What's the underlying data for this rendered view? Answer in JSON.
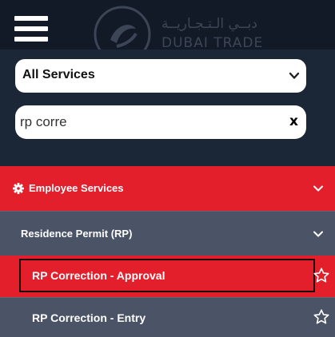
{
  "header": {
    "logo_arabic": "دبــي الـتـجـاريــة",
    "logo_english": "DUBAI TRADE"
  },
  "filters": {
    "service_select": "All Services",
    "search_value": "rp corre",
    "clear_label": "x"
  },
  "menu": {
    "employee_services": "Employee Services",
    "residence_permit": "Residence Permit (RP)",
    "items": [
      {
        "label": "RP Correction - Approval",
        "selected": true
      },
      {
        "label": "RP Correction - Entry",
        "selected": false
      }
    ]
  },
  "colors": {
    "header_bg": "#121a28",
    "panel_bg": "#1b2637",
    "accent_red": "#e21f2b",
    "row_gray": "#4a5466",
    "text_white": "#ffffff"
  },
  "icons": {
    "menu": "hamburger-icon",
    "logo": "dubai-trade-logo-icon",
    "select": "chevron-down-icon",
    "category": "gear-icon",
    "expand": "chevron-down-icon",
    "favorite": "star-outline-icon"
  }
}
